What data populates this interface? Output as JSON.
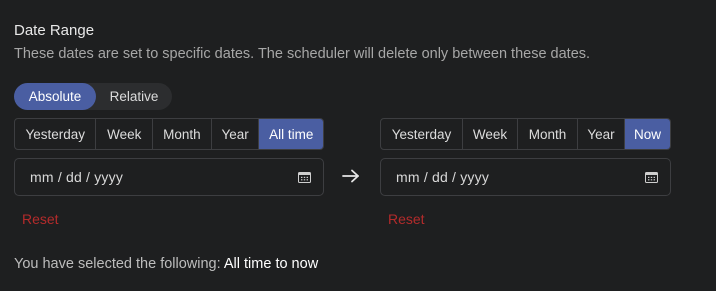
{
  "section": {
    "title": "Date Range",
    "description": "These dates are set to specific dates. The scheduler will delete only between these dates."
  },
  "mode_toggle": {
    "options": [
      "Absolute",
      "Relative"
    ],
    "selected": "Absolute"
  },
  "start": {
    "presets": [
      "Yesterday",
      "Week",
      "Month",
      "Year",
      "All time"
    ],
    "selected": "All time",
    "date_placeholder": "mm / dd / yyyy",
    "reset_label": "Reset"
  },
  "end": {
    "presets": [
      "Yesterday",
      "Week",
      "Month",
      "Year",
      "Now"
    ],
    "selected": "Now",
    "date_placeholder": "mm / dd / yyyy",
    "reset_label": "Reset"
  },
  "summary": {
    "prefix": "You have selected the following:",
    "value": "All time to now"
  },
  "colors": {
    "accent": "#4a5ea2",
    "reset": "#b42b2b",
    "background": "#1e1f20"
  }
}
